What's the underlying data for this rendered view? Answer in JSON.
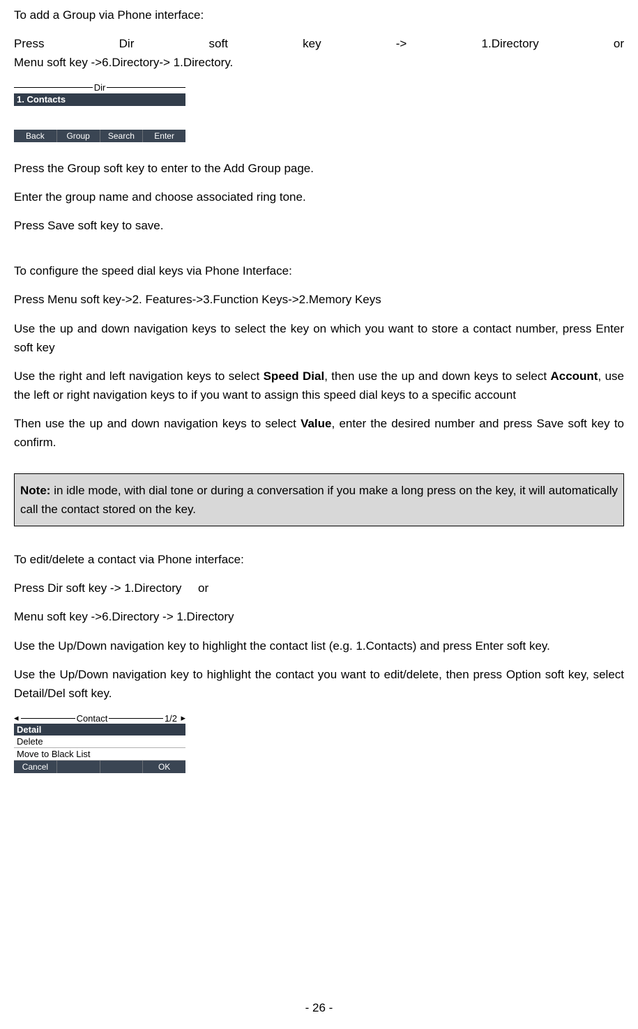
{
  "p1": "To add a Group via Phone interface:",
  "p2a_words": [
    "Press",
    "Dir",
    "soft",
    "key",
    "->",
    "1.Directory",
    "or"
  ],
  "p2b": "Menu soft key ->6.Directory-> 1.Directory.",
  "shot1": {
    "title": "Dir",
    "selected": "1. Contacts",
    "sk": [
      "Back",
      "Group",
      "Search",
      "Enter"
    ]
  },
  "p3": "Press the Group soft key to enter to the Add Group page.",
  "p4": "Enter the group name and choose associated ring tone.",
  "p5": "Press Save soft key to save.",
  "p6": "To configure the speed dial keys via Phone Interface:",
  "p7": "Press Menu soft key->2. Features->3.Function Keys->2.Memory Keys",
  "p8": "Use the up and down navigation keys to select the key on which you want to store a contact number, press Enter soft key",
  "p9_pre": "Use the right and left navigation keys to select ",
  "p9_b1": "Speed Dial",
  "p9_mid": ", then use the up and down keys to select ",
  "p9_b2": "Account",
  "p9_post": ", use the left or right navigation keys to if you want to assign this speed dial keys to a specific account",
  "p10_pre": "Then use the up and down navigation keys to select ",
  "p10_b": "Value",
  "p10_post": ", enter the desired number and press Save soft key to confirm.",
  "note_b": "Note:",
  "note_txt": " in idle mode, with dial tone or during a conversation if you make a long press on the key, it will automatically call the contact stored on the key.",
  "p11": "To edit/delete a contact via Phone interface:",
  "p12": "Press Dir soft key -> 1.Directory     or",
  "p13": "Menu soft key ->6.Directory -> 1.Directory",
  "p14": "Use the Up/Down navigation key to highlight the contact list (e.g. 1.Contacts) and press Enter soft key.",
  "p15": "Use the Up/Down navigation key to highlight the contact you want to edit/delete, then press Option soft key, select Detail/Del soft key.",
  "shot2": {
    "arrow_l": "◂",
    "title": "Contact",
    "page": "1/2",
    "arrow_r": "▸",
    "rows": [
      "Detail",
      "Delete",
      "Move to Black List"
    ],
    "sk": [
      "Cancel",
      "",
      "",
      "OK"
    ]
  },
  "footer": "- 26 -"
}
